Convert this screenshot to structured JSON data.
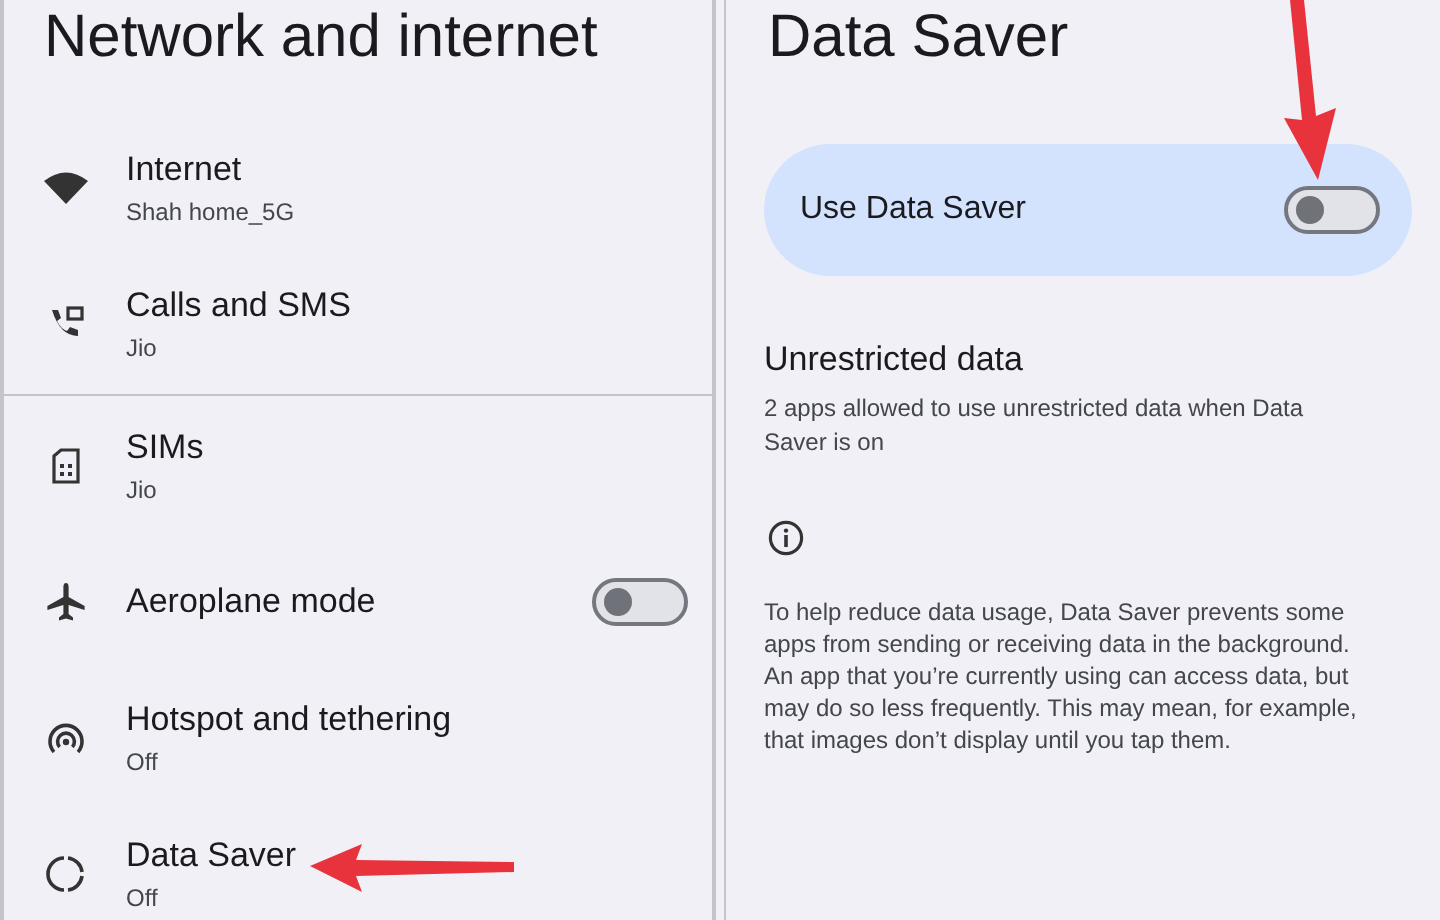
{
  "network_panel": {
    "title": "Network and internet",
    "groups": [
      [
        {
          "title": "Internet",
          "subtitle": "Shah home_5G"
        },
        {
          "title": "Calls and SMS",
          "subtitle": "Jio"
        }
      ],
      [
        {
          "title": "SIMs",
          "subtitle": "Jio"
        },
        {
          "title": "Aeroplane mode",
          "kind": "toggle",
          "on": false
        },
        {
          "title": "Hotspot and tethering",
          "subtitle": "Off"
        },
        {
          "title": "Data Saver",
          "subtitle": "Off"
        }
      ]
    ]
  },
  "data_saver_panel": {
    "title": "Data Saver",
    "main_toggle": {
      "label": "Use Data Saver",
      "on": false
    },
    "unrestricted": {
      "title": "Unrestricted data",
      "subtitle": "2 apps allowed to use unrestricted data when Data Saver is on"
    },
    "info": "To help reduce data usage, Data Saver prevents some apps from sending or receiving data in the background. An app that you’re currently using can access data, but may do so less frequently. This may mean, for example, that images don’t display until you tap them."
  }
}
